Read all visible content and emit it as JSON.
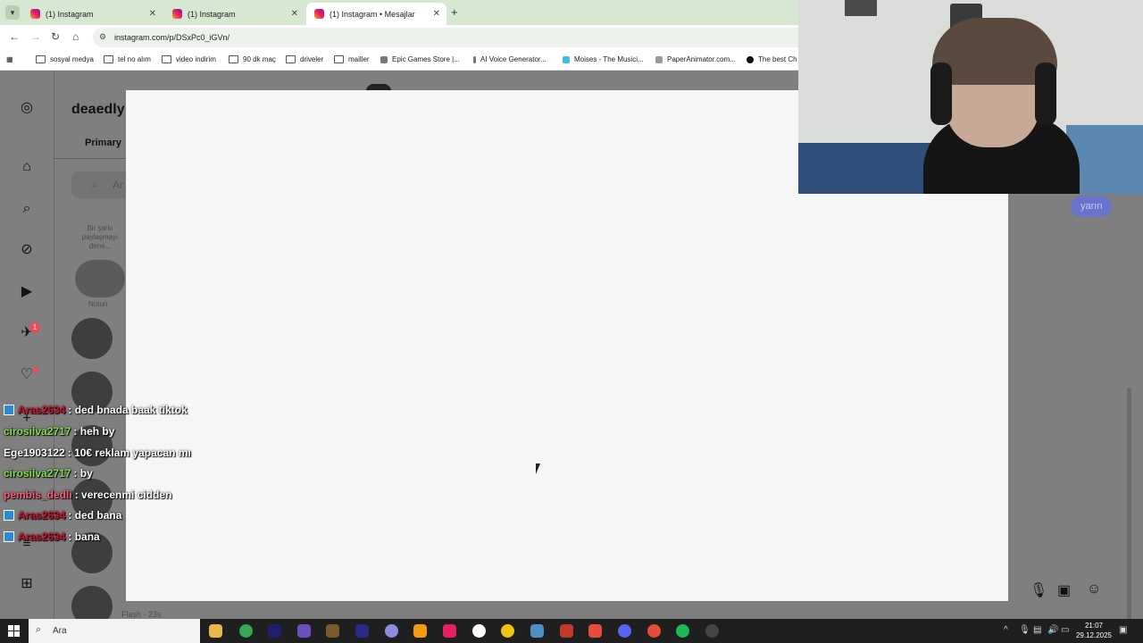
{
  "browser": {
    "tabs": [
      {
        "title": "(1) Instagram",
        "active": false
      },
      {
        "title": "(1) Instagram",
        "active": false
      },
      {
        "title": "(1) Instagram • Mesajlar",
        "active": true
      }
    ],
    "url": "instagram.com/p/DSxPc0_iGVn/",
    "bookmarks": [
      "sosyal medya",
      "tel no alım",
      "video indirim",
      "90 dk maç",
      "driveler",
      "mailler",
      "Epic Games Store |...",
      "AI Voice Generator...",
      "Moises - The Musici...",
      "PaperAnimator.com...",
      "The best Ch"
    ]
  },
  "instagram": {
    "username": "deaedly",
    "primary_tab": "Primary",
    "search_placeholder": "Ar",
    "note_text": "Bir şarkı paylaşmayı dene...",
    "note_label": "Notun",
    "last_message_time": "Flash · 23s",
    "notification_count": "1",
    "reply_bubble": "yarın"
  },
  "chat": [
    {
      "user": "Aras2634",
      "message": ": ded bnada baak tiktok",
      "user_color": "#d0112b",
      "badge": true
    },
    {
      "user": "cirosilva2717",
      "message": ": heh by",
      "user_color": "#7fe04a",
      "badge": false
    },
    {
      "user": "Ege1903122",
      "message": ": 10€ reklam yapacan mı",
      "user_color": "#ffffff",
      "badge": false
    },
    {
      "user": "cirosilva2717",
      "message": ": by",
      "user_color": "#7fe04a",
      "badge": false
    },
    {
      "user": "pembis_dedli",
      "message": ": verecenmi cidden",
      "user_color": "#ff5c7a",
      "badge": false
    },
    {
      "user": "Aras2634",
      "message": ": ded bana",
      "user_color": "#d0112b",
      "badge": true
    },
    {
      "user": "Aras2634",
      "message": ": bana",
      "user_color": "#d0112b",
      "badge": true
    }
  ],
  "taskbar": {
    "search_placeholder": "Ara",
    "time": "21:07",
    "date": "29.12.2025"
  }
}
